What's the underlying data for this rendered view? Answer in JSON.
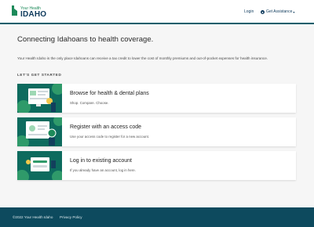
{
  "header": {
    "logo_small": "Your Health",
    "logo_big": "IDAHO",
    "login_label": "Login",
    "assistance_label": "Get Assistance",
    "assistance_icon": "person-icon",
    "chevron_icon": "chevron-down-icon"
  },
  "main": {
    "title": "Connecting Idahoans to health coverage.",
    "subtitle": "Your Health Idaho is the only place Idahoans can receive a tax credit to lower the cost of monthly premiums and out-of-pocket expenses for health insurance.",
    "section_label": "LET'S GET STARTED",
    "cards": [
      {
        "title": "Browse for health & dental plans",
        "description": "Shop. Compare. Choose.",
        "illustration": "browse-plans-illustration"
      },
      {
        "title": "Register with an access code",
        "description": "Use your access code to register for a new account.",
        "illustration": "access-code-illustration"
      },
      {
        "title": "Log in to existing account",
        "description": "If you already have an account, log in here.",
        "illustration": "login-illustration"
      }
    ]
  },
  "footer": {
    "copyright": "©2022 Your Health Idaho",
    "privacy_label": "Privacy Policy"
  },
  "colors": {
    "brand_navy": "#0e3a5c",
    "brand_green": "#1d8a5a",
    "card_teal": "#0d6b5e",
    "footer_bg": "#0d4a5e"
  }
}
